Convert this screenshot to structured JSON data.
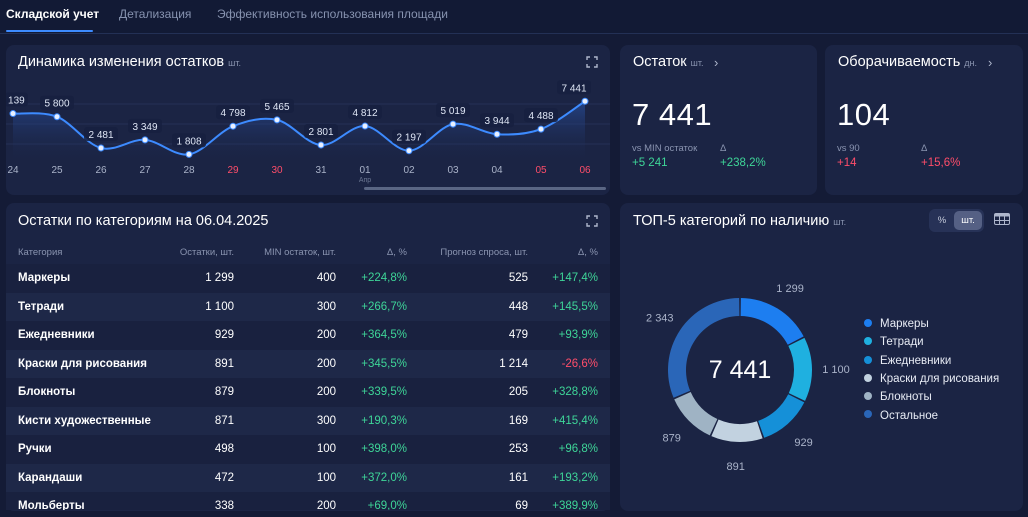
{
  "tabs": [
    {
      "label": "Складской учет",
      "active": true
    },
    {
      "label": "Детализация",
      "active": false
    },
    {
      "label": "Эффективность использования площади",
      "active": false
    }
  ],
  "dynamics": {
    "title": "Динамика изменения остатков",
    "unit": "шт.",
    "month_label": "Апр"
  },
  "chart_data": {
    "type": "line",
    "title": "Динамика изменения остатков",
    "ylabel": "шт.",
    "categories": [
      "24",
      "25",
      "26",
      "27",
      "28",
      "29",
      "30",
      "31",
      "01",
      "02",
      "03",
      "04",
      "05",
      "06"
    ],
    "weekend": [
      false,
      false,
      false,
      false,
      false,
      true,
      true,
      false,
      false,
      false,
      false,
      false,
      true,
      true
    ],
    "values": [
      6139,
      5800,
      2481,
      3349,
      1808,
      4798,
      5465,
      2801,
      4812,
      2197,
      5019,
      3944,
      4488,
      7441
    ],
    "labels": [
      "139",
      "5 800",
      "2 481",
      "3 349",
      "1 808",
      "4 798",
      "5 465",
      "2 801",
      "4 812",
      "2 197",
      "5 019",
      "3 944",
      "4 488",
      "7 441"
    ],
    "ylim": [
      1000,
      8000
    ],
    "line_color": "#3d8bff"
  },
  "stock": {
    "title": "Остаток",
    "unit": "шт.",
    "value": "7 441",
    "cmp_label": "vs MIN остаток",
    "delta_label": "Δ",
    "cmp_value": "+5 241",
    "delta_value": "+238,2%"
  },
  "turnover": {
    "title": "Оборачиваемость",
    "unit": "дн.",
    "value": "104",
    "cmp_label": "vs 90",
    "delta_label": "Δ",
    "cmp_value": "+14",
    "delta_value": "+15,6%"
  },
  "categories_table": {
    "title": "Остатки по категориям на 06.04.2025",
    "headers": [
      "Категория",
      "Остатки, шт.",
      "MIN остаток, шт.",
      "Δ, %",
      "Прогноз спроса, шт.",
      "Δ, %"
    ],
    "rows": [
      {
        "name": "Маркеры",
        "stock": "1 299",
        "min": "400",
        "d1": "+224,8%",
        "forecast": "525",
        "d2": "+147,4%",
        "d2neg": false
      },
      {
        "name": "Тетради",
        "stock": "1 100",
        "min": "300",
        "d1": "+266,7%",
        "forecast": "448",
        "d2": "+145,5%",
        "d2neg": false
      },
      {
        "name": "Ежедневники",
        "stock": "929",
        "min": "200",
        "d1": "+364,5%",
        "forecast": "479",
        "d2": "+93,9%",
        "d2neg": false
      },
      {
        "name": "Краски для рисования",
        "stock": "891",
        "min": "200",
        "d1": "+345,5%",
        "forecast": "1 214",
        "d2": "-26,6%",
        "d2neg": true
      },
      {
        "name": "Блокноты",
        "stock": "879",
        "min": "200",
        "d1": "+339,5%",
        "forecast": "205",
        "d2": "+328,8%",
        "d2neg": false
      },
      {
        "name": "Кисти художественные",
        "stock": "871",
        "min": "300",
        "d1": "+190,3%",
        "forecast": "169",
        "d2": "+415,4%",
        "d2neg": false
      },
      {
        "name": "Ручки",
        "stock": "498",
        "min": "100",
        "d1": "+398,0%",
        "forecast": "253",
        "d2": "+96,8%",
        "d2neg": false
      },
      {
        "name": "Карандаши",
        "stock": "472",
        "min": "100",
        "d1": "+372,0%",
        "forecast": "161",
        "d2": "+193,2%",
        "d2neg": false
      },
      {
        "name": "Мольберты",
        "stock": "338",
        "min": "200",
        "d1": "+69,0%",
        "forecast": "69",
        "d2": "+389,9%",
        "d2neg": false
      }
    ]
  },
  "top5": {
    "title": "ТОП-5 категорий по наличию",
    "unit": "шт.",
    "toggle": [
      "%",
      "шт."
    ],
    "total": "7 441",
    "legend": [
      {
        "name": "Маркеры",
        "value": 1299,
        "label": "1 299",
        "color": "#1d7ef0"
      },
      {
        "name": "Тетради",
        "value": 1100,
        "label": "1 100",
        "color": "#1fb0e0"
      },
      {
        "name": "Ежедневники",
        "value": 929,
        "label": "929",
        "color": "#1590d8"
      },
      {
        "name": "Краски для рисования",
        "value": 891,
        "label": "891",
        "color": "#c2d2e0"
      },
      {
        "name": "Блокноты",
        "value": 879,
        "label": "879",
        "color": "#9fb3c4"
      },
      {
        "name": "Остальное",
        "value": 2343,
        "label": "2 343",
        "color": "#2a66b8"
      }
    ]
  }
}
